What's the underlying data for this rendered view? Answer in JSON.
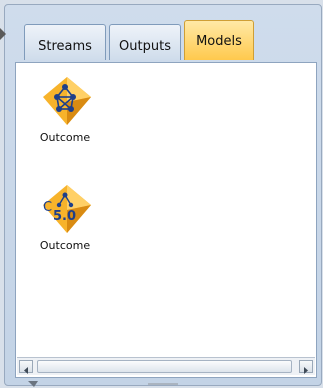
{
  "tabs": [
    {
      "label": "Streams",
      "active": false
    },
    {
      "label": "Outputs",
      "active": false
    },
    {
      "label": "Models",
      "active": true
    }
  ],
  "models": [
    {
      "label": "Outcome",
      "icon": "neural-network-model-icon"
    },
    {
      "label": "Outcome",
      "icon": "c50-tree-model-icon",
      "badge": "5.0",
      "prefix": "C"
    }
  ],
  "colors": {
    "active_tab": "#ffc94d",
    "nugget_gold": "#f5a623",
    "panel_bg": "#ffffff",
    "frame_bg": "#c9d7e8"
  }
}
